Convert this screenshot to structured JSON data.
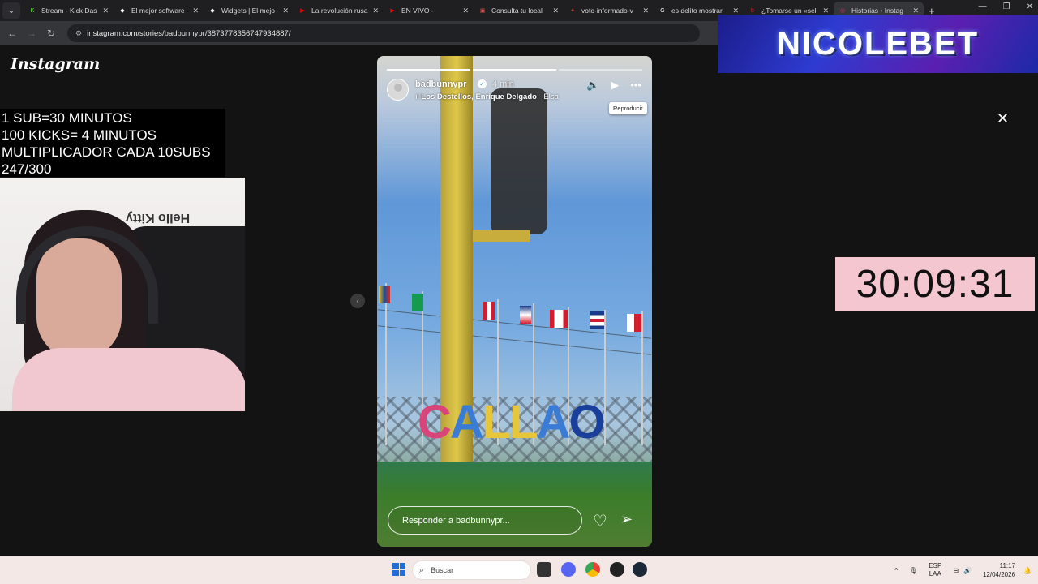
{
  "browser": {
    "tabs": [
      {
        "title": "Stream - Kick Das",
        "color": "#53fc18",
        "icon": "K"
      },
      {
        "title": "El mejor software",
        "color": "#ffffff",
        "icon": "◆"
      },
      {
        "title": "Widgets | El mejo",
        "color": "#ffffff",
        "icon": "◆"
      },
      {
        "title": "La revolución rusa",
        "color": "#ff0000",
        "icon": "▶"
      },
      {
        "title": "EN VIVO -",
        "color": "#ff0000",
        "icon": "▶"
      },
      {
        "title": "Consulta tu local",
        "color": "#e05050",
        "icon": "▣"
      },
      {
        "title": "voto-informado-v",
        "color": "#c0392b",
        "icon": "✦"
      },
      {
        "title": "es delito mostrar",
        "color": "#ffffff",
        "icon": "G"
      },
      {
        "title": "¿Tomarse un «sel",
        "color": "#d62020",
        "icon": "b"
      },
      {
        "title": "Historias • Instag",
        "color": "#e1306c",
        "icon": "◎"
      }
    ],
    "active_tab_index": 9,
    "url": "instagram.com/stories/badbunnypr/3873778356747934887/"
  },
  "overlay": {
    "logo": "Instagram",
    "sub_lines": [
      "1 SUB=30 MINUTOS",
      "100 KICKS= 4 MINUTOS",
      "MULTIPLICADOR CADA 10SUBS",
      "247/300"
    ],
    "webcam_text": "Hello Kitty",
    "timer": "30:09:31",
    "banner": "NICOLEBET"
  },
  "story": {
    "progress_total": 3,
    "progress_done": 2,
    "username": "badbunnypr",
    "time_ago": "4 min",
    "music_artist": "Los Destellos, Enrique Delgado",
    "music_song": "Elsa",
    "tooltip": "Reproducir",
    "sign_text": "CALLAO",
    "reply_placeholder": "Responder a badbunnypr..."
  },
  "taskbar": {
    "search_placeholder": "Buscar",
    "lang_top": "ESP",
    "lang_bottom": "LAA",
    "time": "11:17",
    "date": "12/04/2026"
  }
}
